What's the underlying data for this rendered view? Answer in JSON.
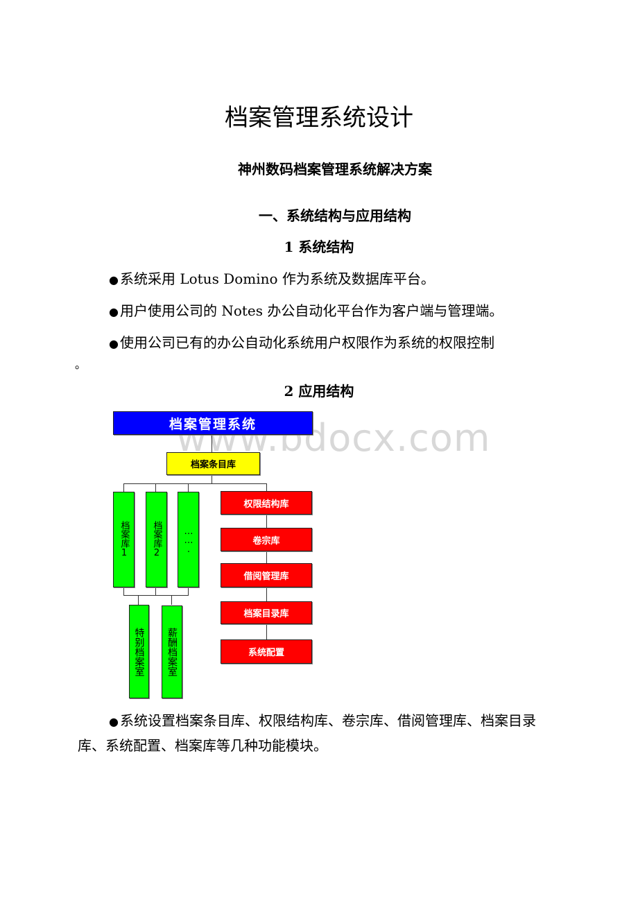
{
  "document": {
    "title": "档案管理系统设计",
    "subtitle": "神州数码档案管理系统解决方案",
    "section1": "一、系统结构与应用结构",
    "subsection1": "1 系统结构",
    "bullets1": [
      "系统采用 Lotus Domino 作为系统及数据库平台。",
      "用户使用公司的 Notes 办公自动化平台作为客户端与管理端。",
      "使用公司已有的办公自动化系统用户权限作为系统的权限控制",
      "。"
    ],
    "subsection2": "2 应用结构",
    "summary_bullet": "系统设置档案条目库、权限结构库、卷宗库、借阅管理库、档案目录库、系统配置、档案库等几种功能模块。",
    "watermark": "www.bdocx.com"
  },
  "diagram": {
    "root": "档案管理系统",
    "catalog": "档案条目库",
    "archives": [
      "档案库1",
      "档案库2",
      "……."
    ],
    "special_rooms": [
      "特别档案室",
      "薪酬档案室"
    ],
    "modules": [
      "权限结构库",
      "卷宗库",
      "借阅管理库",
      "档案目录库",
      "系统配置"
    ],
    "colors": {
      "root": "#0000ff",
      "catalog": "#ffff00",
      "archive": "#00ff00",
      "module": "#ff0000"
    }
  }
}
